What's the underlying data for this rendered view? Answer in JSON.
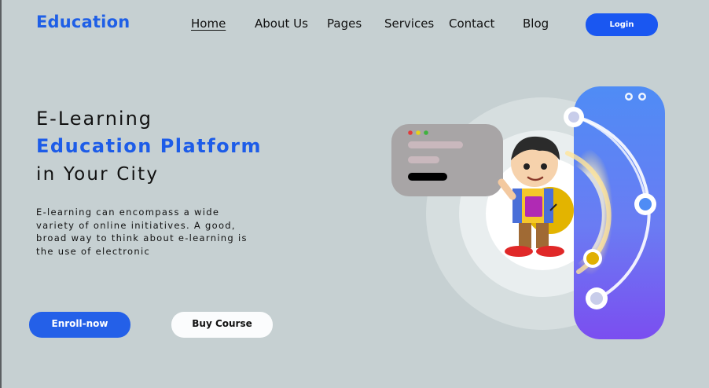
{
  "brand": {
    "name": "Education"
  },
  "nav": {
    "items": [
      {
        "label": "Home",
        "active": true
      },
      {
        "label": "About Us"
      },
      {
        "label": "Pages"
      },
      {
        "label": "Services"
      },
      {
        "label": "Contact"
      },
      {
        "label": "Blog"
      }
    ],
    "login_label": "Login"
  },
  "hero": {
    "line1": "E-Learning",
    "line2": "Education Platform",
    "line3": "in Your City",
    "description_lines": [
      "E-learning can encompass a wide",
      "variety of online initiatives. A good,",
      "broad way to think about e-learning is",
      "the use of electronic"
    ],
    "enroll_label": "Enroll-now",
    "buy_label": "Buy Course"
  },
  "colors": {
    "background": "#c6d0d2",
    "brand_blue": "#1d5ce8",
    "accent_yellow": "#e8b800",
    "phone_gradient_top": "#4f8cf5",
    "phone_gradient_bottom": "#7b4ef0"
  },
  "icons": {
    "illustration": "student-with-laptop-illustration",
    "browser": "browser-window-icon",
    "phone": "mobile-phone-icon"
  }
}
